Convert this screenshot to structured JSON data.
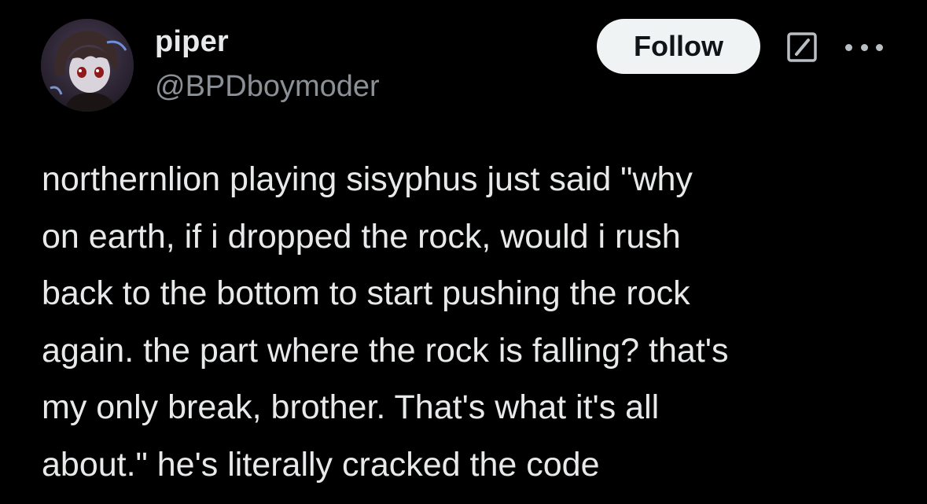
{
  "author": {
    "display_name": "piper",
    "handle": "@BPDboymoder",
    "avatar_icon": "anime-character-avatar"
  },
  "actions": {
    "follow_label": "Follow",
    "grok_icon": "grok-icon",
    "more_icon": "more-options-icon"
  },
  "tweet": {
    "lines": [
      "northernlion playing sisyphus just said \"why",
      "on earth, if i dropped the rock, would i rush",
      "back to the bottom to start pushing the rock",
      "again. the part where the rock is falling? that's",
      "my only break, brother. That's what it's all",
      "about.\" he's literally cracked the code"
    ]
  },
  "colors": {
    "background": "#000000",
    "text_primary": "#e7e9ea",
    "text_secondary": "#8b9096",
    "button_bg": "#eff3f4",
    "button_text": "#0f1419"
  }
}
